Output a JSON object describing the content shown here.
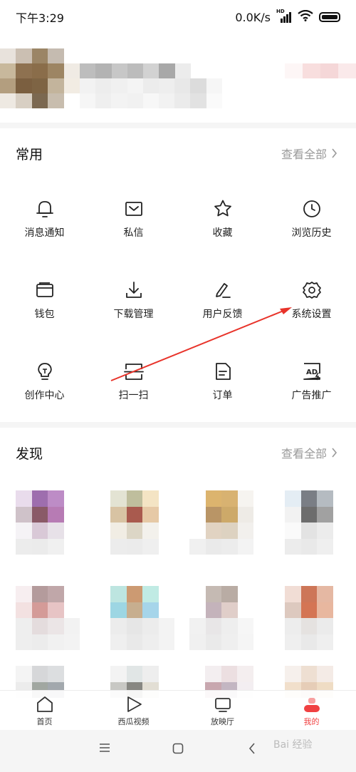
{
  "status_bar": {
    "time": "下午3:29",
    "network_speed": "0.0K/s",
    "network_type": "HD"
  },
  "common": {
    "title": "常用",
    "see_all": "查看全部",
    "items": [
      {
        "label": "消息通知",
        "icon": "bell-icon"
      },
      {
        "label": "私信",
        "icon": "mail-icon"
      },
      {
        "label": "收藏",
        "icon": "star-icon"
      },
      {
        "label": "浏览历史",
        "icon": "clock-icon"
      },
      {
        "label": "钱包",
        "icon": "wallet-icon"
      },
      {
        "label": "下载管理",
        "icon": "download-icon"
      },
      {
        "label": "用户反馈",
        "icon": "pen-icon"
      },
      {
        "label": "系统设置",
        "icon": "gear-icon"
      },
      {
        "label": "创作中心",
        "icon": "bulb-icon"
      },
      {
        "label": "扫一扫",
        "icon": "scan-icon"
      },
      {
        "label": "订单",
        "icon": "document-icon"
      },
      {
        "label": "广告推广",
        "icon": "ad-icon"
      }
    ]
  },
  "discover": {
    "title": "发现",
    "see_all": "查看全部"
  },
  "tabbar": [
    {
      "label": "首页",
      "icon": "home-icon"
    },
    {
      "label": "西瓜视频",
      "icon": "play-icon"
    },
    {
      "label": "放映厅",
      "icon": "tv-icon"
    },
    {
      "label": "我的",
      "icon": "profile-icon",
      "active": true
    }
  ],
  "watermark": "Bai 经验",
  "colors": {
    "accent": "#f04142",
    "annotation_arrow": "#e8332a"
  }
}
